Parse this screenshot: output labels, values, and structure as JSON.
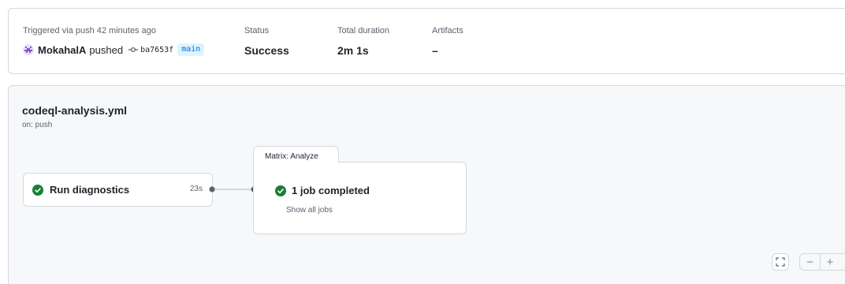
{
  "summary": {
    "trigger_label": "Triggered via push 42 minutes ago",
    "actor": "MokahalA",
    "action": "pushed",
    "commit_sha": "ba7653f",
    "branch": "main",
    "status_label": "Status",
    "status_value": "Success",
    "duration_label": "Total duration",
    "duration_value": "2m 1s",
    "artifacts_label": "Artifacts",
    "artifacts_value": "–"
  },
  "workflow": {
    "name": "codeql-analysis.yml",
    "trigger": "on: push"
  },
  "jobs": [
    {
      "name": "Run diagnostics",
      "duration": "23s",
      "status": "success"
    }
  ],
  "matrix": {
    "tab_label": "Matrix: Analyze",
    "status_text": "1 job completed",
    "show_all": "Show all jobs"
  },
  "controls": {
    "zoom_out": "−",
    "zoom_in": "+"
  },
  "colors": {
    "success": "#1a7f37",
    "accent": "#0969da",
    "border": "#d1d9e0"
  },
  "icons": {
    "avatar": "avatar-icon",
    "commit": "git-commit-icon",
    "check": "check-circle-fill-icon",
    "fullscreen": "screen-full-icon"
  }
}
